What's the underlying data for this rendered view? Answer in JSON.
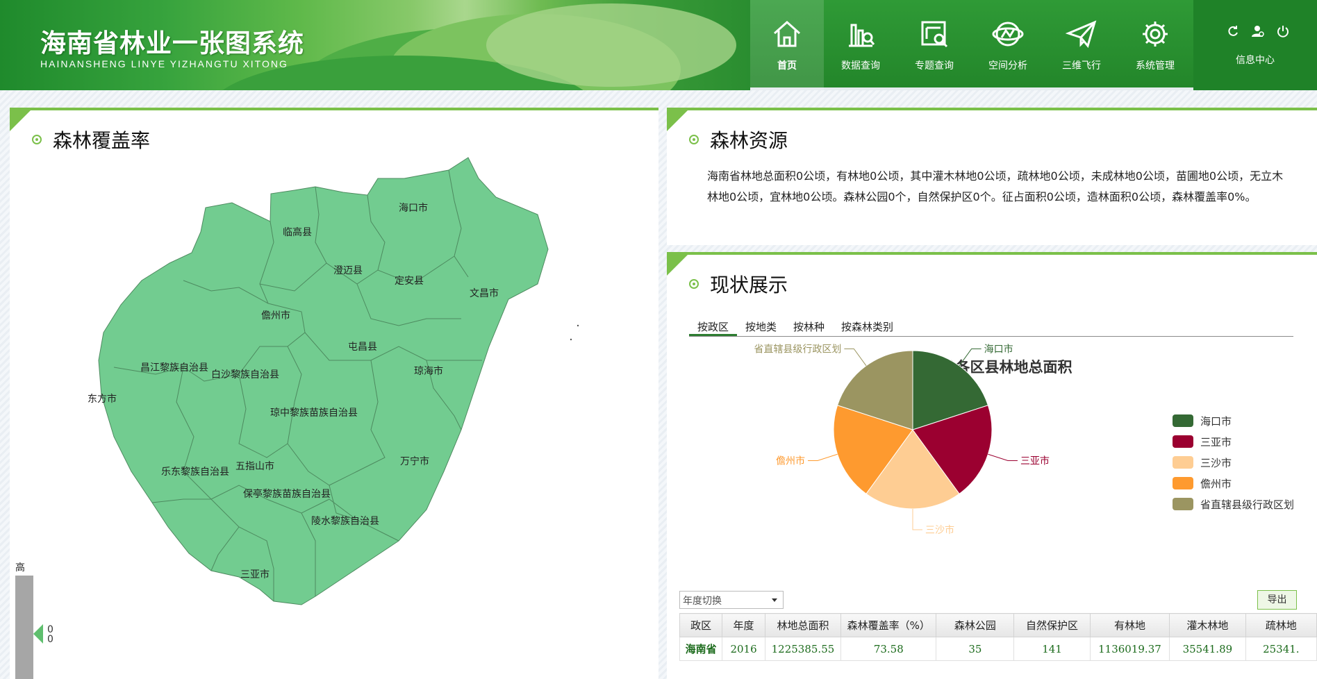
{
  "header": {
    "title_cn": "海南省林业一张图系统",
    "title_en": "HAINANSHENG LINYE YIZHANGTU XITONG",
    "nav": [
      {
        "label": "首页",
        "icon": "home-icon"
      },
      {
        "label": "数据查询",
        "icon": "data-query-icon"
      },
      {
        "label": "专题查询",
        "icon": "topic-query-icon"
      },
      {
        "label": "空间分析",
        "icon": "spatial-analysis-icon"
      },
      {
        "label": "三维飞行",
        "icon": "paper-plane-icon"
      },
      {
        "label": "系统管理",
        "icon": "gear-icon"
      }
    ],
    "info_center": "信息中心",
    "info_icons": [
      "refresh-icon",
      "user-settings-icon",
      "power-icon"
    ]
  },
  "map_panel": {
    "title": "森林覆盖率",
    "fill_color": "#72cc90",
    "regions": [
      "海口市",
      "临高县",
      "澄迈县",
      "定安县",
      "文昌市",
      "儋州市",
      "屯昌县",
      "琼海市",
      "昌江黎族自治县",
      "白沙黎族自治县",
      "东方市",
      "琼中黎族苗族自治县",
      "五指山市",
      "万宁市",
      "乐东黎族自治县",
      "保亭黎族苗族自治县",
      "陵水黎族自治县",
      "三亚市"
    ],
    "scale": {
      "high_label": "高",
      "value_1": "0",
      "value_2": "0"
    }
  },
  "resource_panel": {
    "title": "森林资源",
    "text": "海南省林地总面积0公顷，有林地0公顷，其中灌木林地0公顷，疏林地0公顷，未成林地0公顷，苗圃地0公顷，无立木林地0公顷，宜林地0公顷。森林公园0个，自然保护区0个。征占面积0公顷，造林面积0公顷，森林覆盖率0%。"
  },
  "status_panel": {
    "title": "现状展示",
    "tabs": [
      "按政区",
      "按地类",
      "按林种",
      "按森林类别"
    ],
    "year_select_placeholder": "年度切换",
    "export_label": "导出",
    "table": {
      "headers": [
        "政区",
        "年度",
        "林地总面积",
        "森林覆盖率（%）",
        "森林公园",
        "自然保护区",
        "有林地",
        "灌木林地",
        "疏林地"
      ],
      "rows": [
        [
          "海南省",
          "2016",
          "1225385.55",
          "73.58",
          "35",
          "141",
          "1136019.37",
          "35541.89",
          "25341."
        ]
      ]
    }
  },
  "chart_data": {
    "type": "pie",
    "title": "海南省各区县林地总面积",
    "legend_position": "right",
    "slices": [
      {
        "name": "海口市",
        "value": 20,
        "color": "#346934"
      },
      {
        "name": "三亚市",
        "value": 20,
        "color": "#9b0030"
      },
      {
        "name": "三沙市",
        "value": 20,
        "color": "#fecd93"
      },
      {
        "name": "儋州市",
        "value": 20,
        "color": "#fe9a2f"
      },
      {
        "name": "省直辖县级行政区划",
        "value": 20,
        "color": "#9b9561"
      }
    ]
  }
}
